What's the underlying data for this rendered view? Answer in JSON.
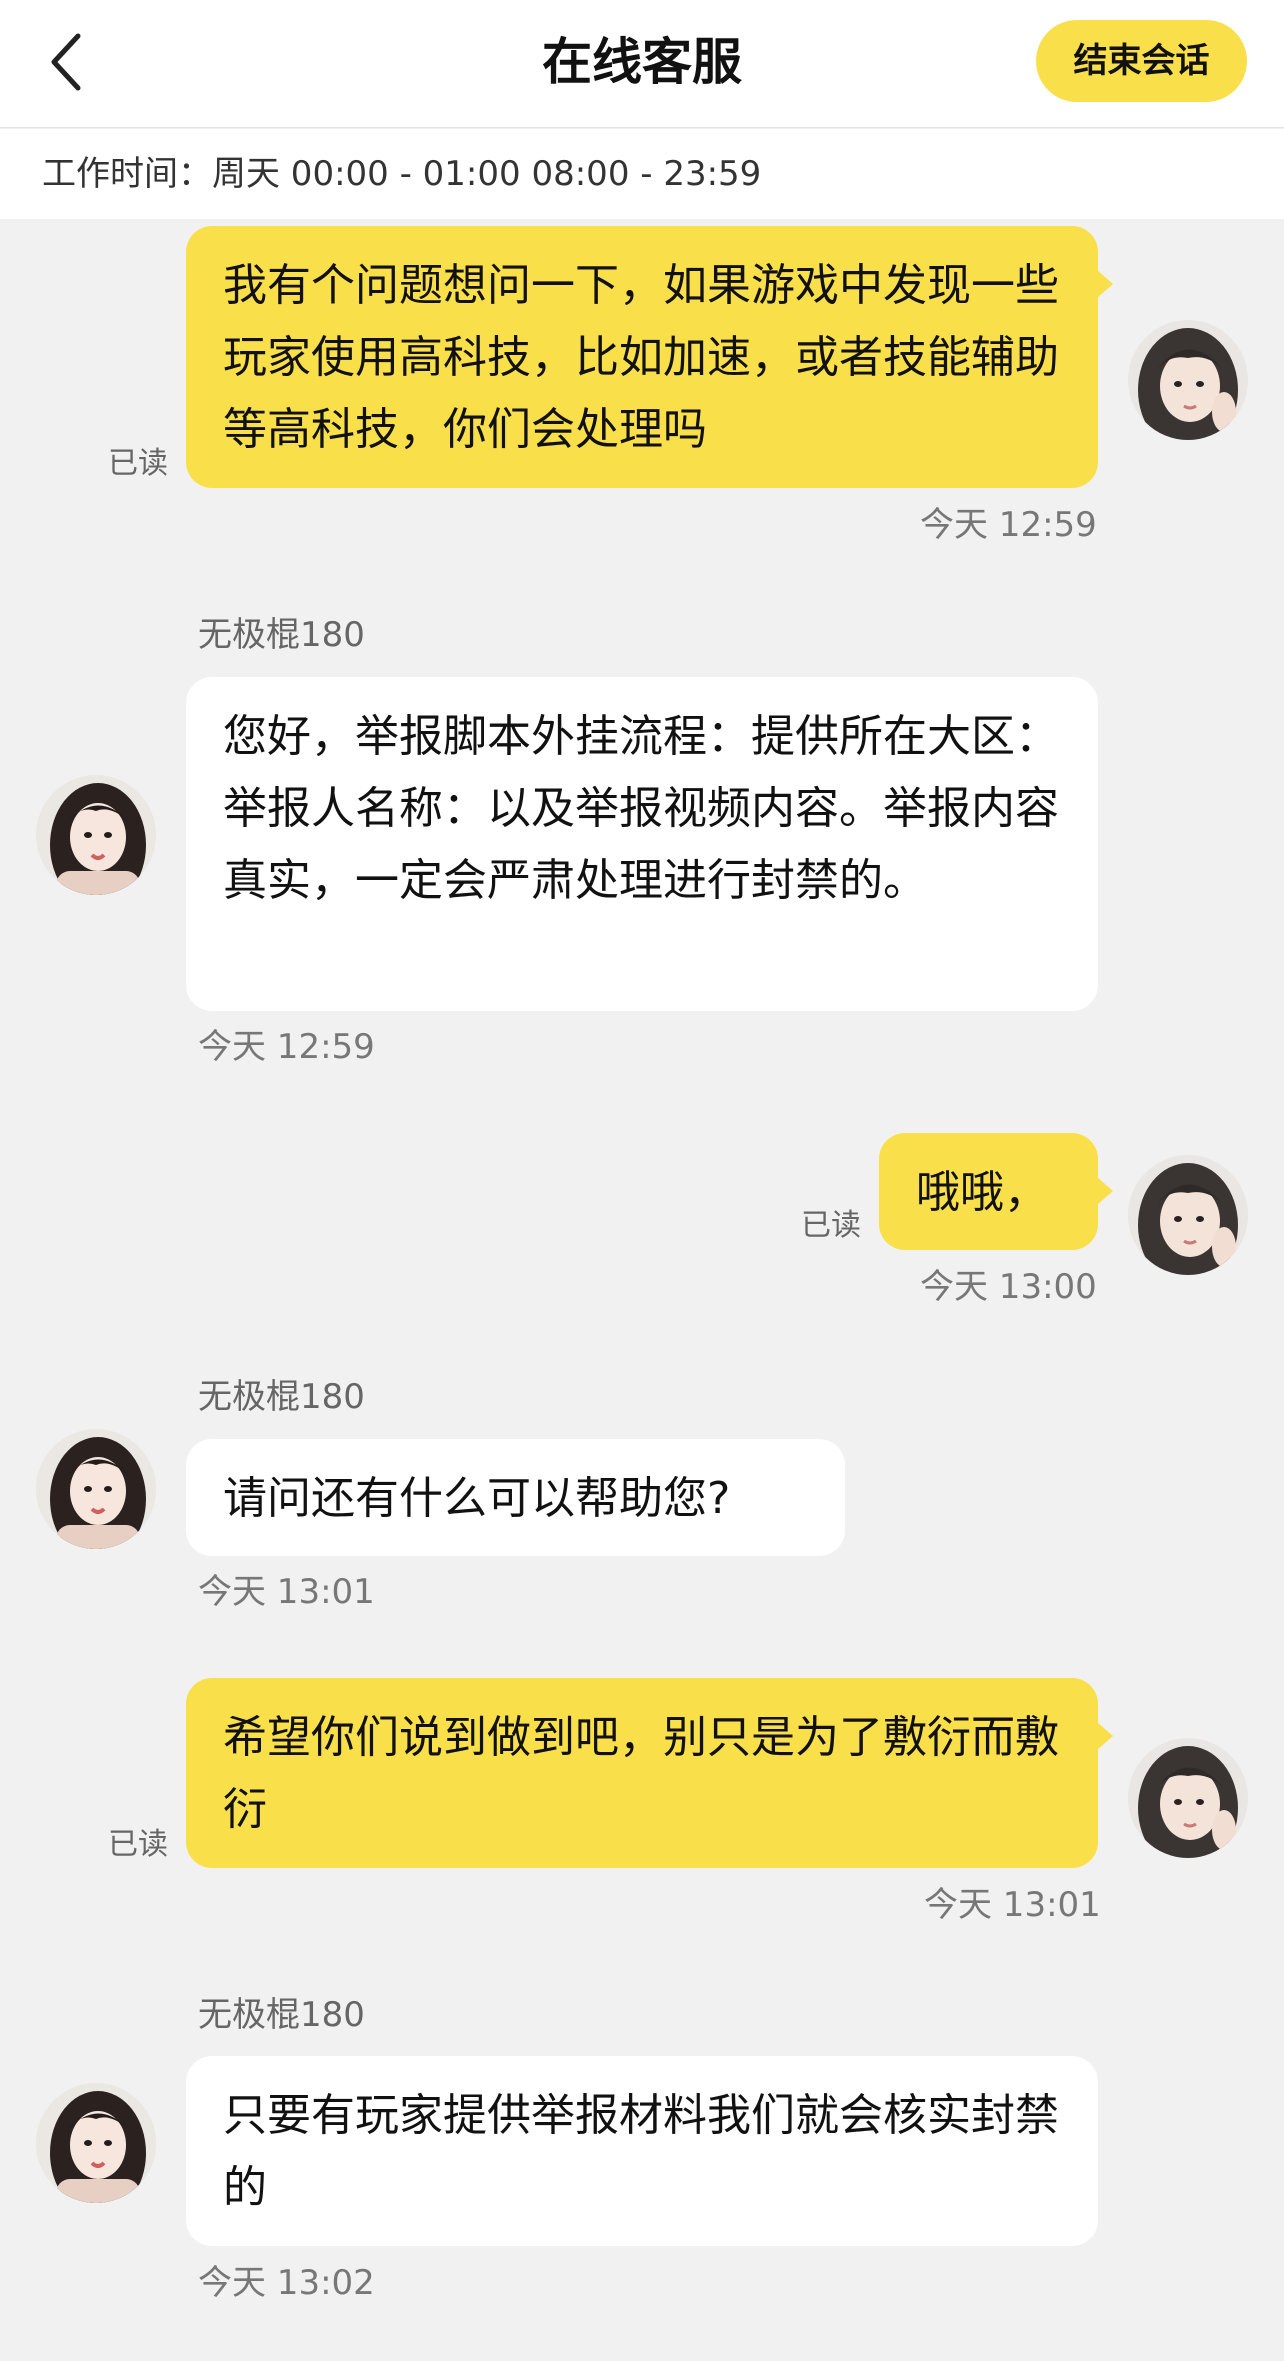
{
  "header": {
    "title": "在线客服",
    "end_button": "结束会话",
    "back_icon": "chevron-left-icon"
  },
  "hours": "工作时间：周天 00:00 - 01:00 08:00 - 23:59",
  "colors": {
    "accent": "#f9df4a",
    "background": "#f1f1f1",
    "bubble_other": "#ffffff"
  },
  "messages": [
    {
      "from": "me",
      "text": "我有个问题想问一下，如果游戏中发现一些玩家使用高科技，比如加速，或者技能辅助等高科技，你们会处理吗",
      "status": "已读",
      "time": "今天 12:59"
    },
    {
      "from": "agent",
      "sender": "无极棍180",
      "text": "您好，举报脚本外挂流程：提供所在大区：举报人名称：以及举报视频内容。举报内容真实，一定会严肃处理进行封禁的。",
      "time": "今天 12:59"
    },
    {
      "from": "me",
      "text": "哦哦，",
      "status": "已读",
      "time": "今天 13:00"
    },
    {
      "from": "agent",
      "sender": "无极棍180",
      "text": "请问还有什么可以帮助您?",
      "time": "今天 13:01"
    },
    {
      "from": "me",
      "text": "希望你们说到做到吧，别只是为了敷衍而敷衍",
      "status": "已读",
      "time": "今天 13:01"
    },
    {
      "from": "agent",
      "sender": "无极棍180",
      "text": "只要有玩家提供举报材料我们就会核实封禁的",
      "time": "今天 13:02"
    }
  ]
}
